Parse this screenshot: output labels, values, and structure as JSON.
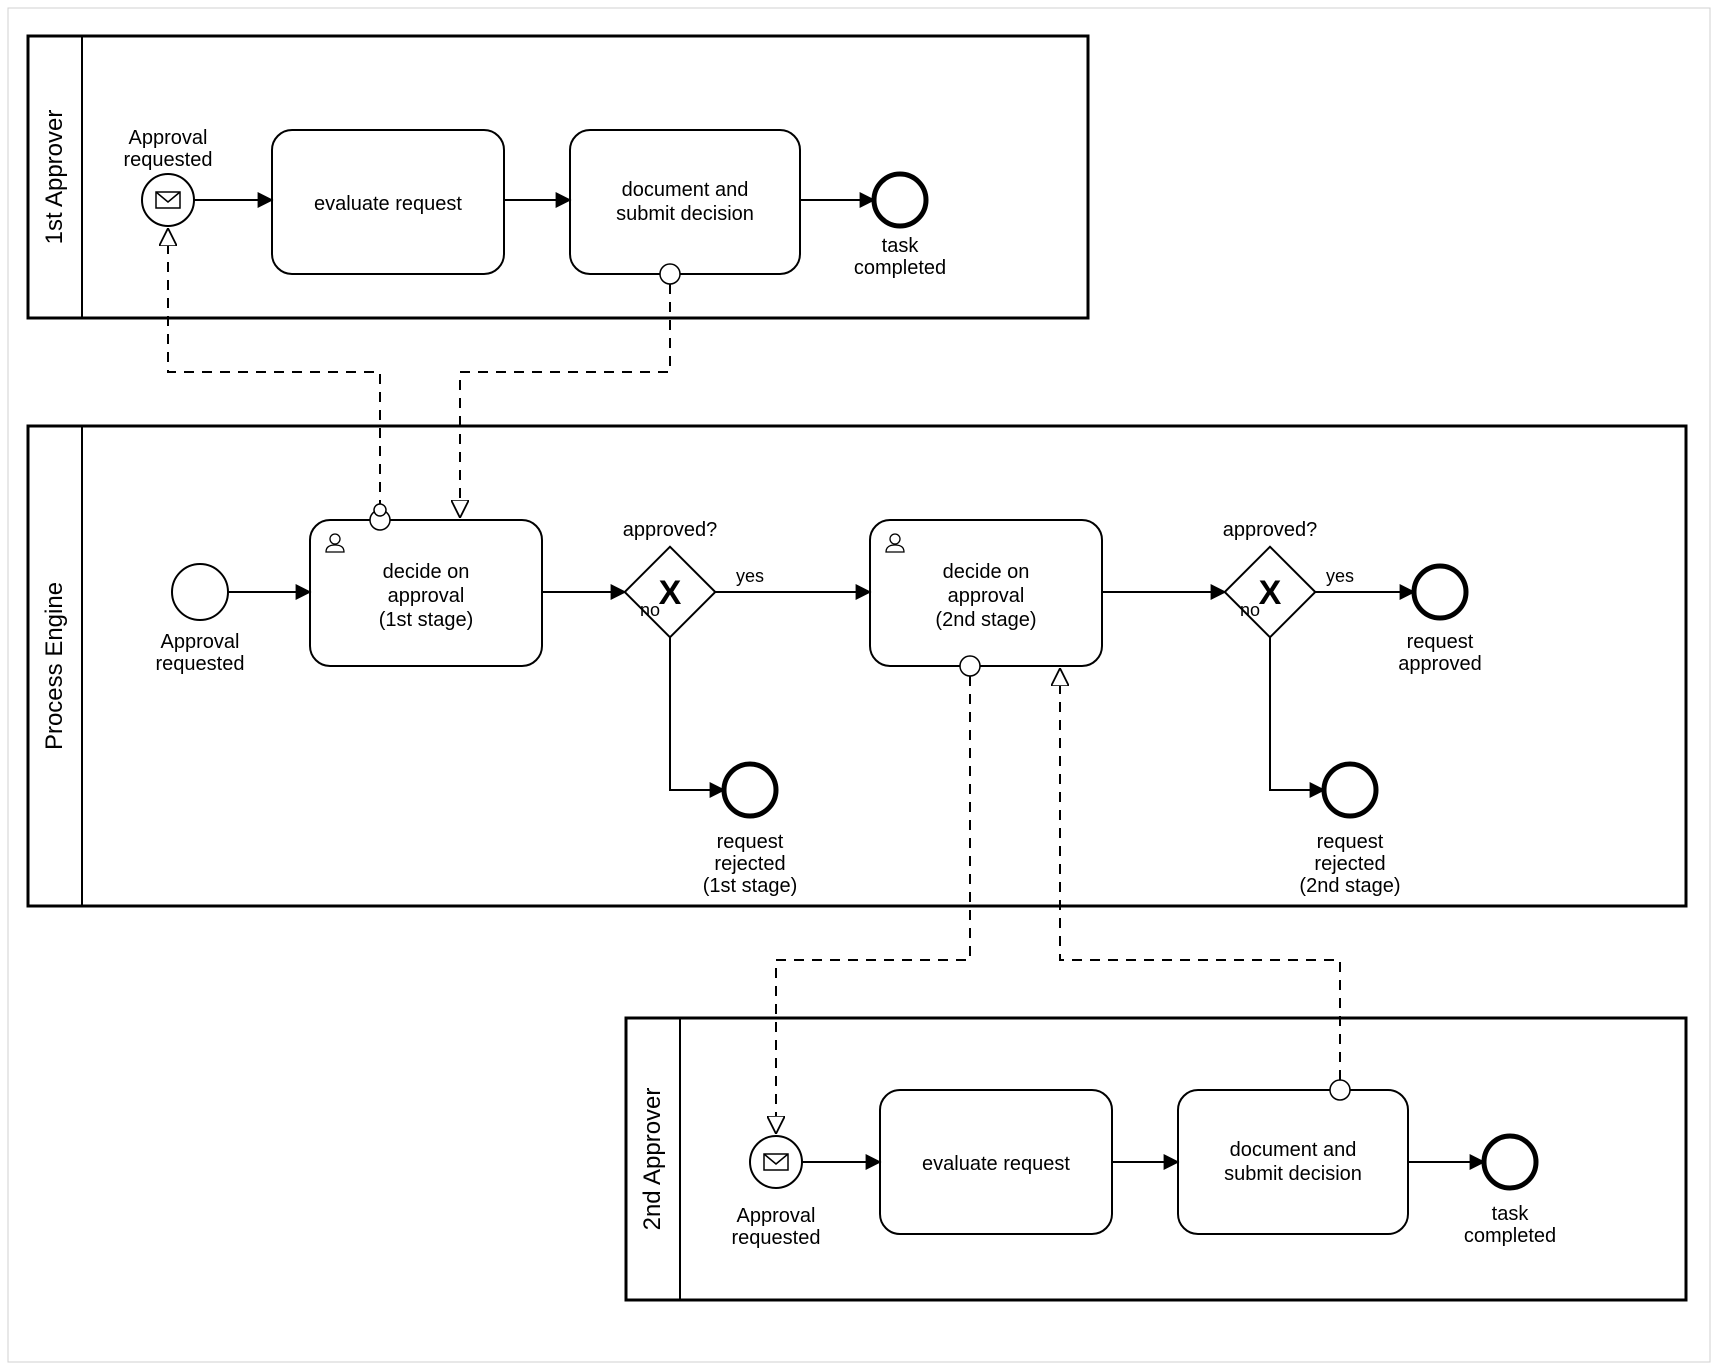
{
  "diagram_type": "BPMN",
  "lanes": {
    "approver1": {
      "title": "1st Approver"
    },
    "engine": {
      "title": "Process Engine"
    },
    "approver2": {
      "title": "2nd Approver"
    }
  },
  "approver1": {
    "start_label1": "Approval",
    "start_label2": "requested",
    "task1": "evaluate request",
    "task2a": "document and",
    "task2b": "submit decision",
    "end_label1": "task",
    "end_label2": "completed"
  },
  "engine": {
    "start_label1": "Approval",
    "start_label2": "requested",
    "task1a": "decide on",
    "task1b": "approval",
    "task1c": "(1st stage)",
    "gw1_label": "approved?",
    "gw1_yes": "yes",
    "gw1_no": "no",
    "rej1a": "request",
    "rej1b": "rejected",
    "rej1c": "(1st stage)",
    "task2a": "decide on",
    "task2b": "approval",
    "task2c": "(2nd stage)",
    "gw2_label": "approved?",
    "gw2_yes": "yes",
    "gw2_no": "no",
    "rej2a": "request",
    "rej2b": "rejected",
    "rej2c": "(2nd stage)",
    "appr_a": "request",
    "appr_b": "approved"
  },
  "approver2": {
    "start_label1": "Approval",
    "start_label2": "requested",
    "task1": "evaluate request",
    "task2a": "document and",
    "task2b": "submit decision",
    "end_label1": "task",
    "end_label2": "completed"
  }
}
